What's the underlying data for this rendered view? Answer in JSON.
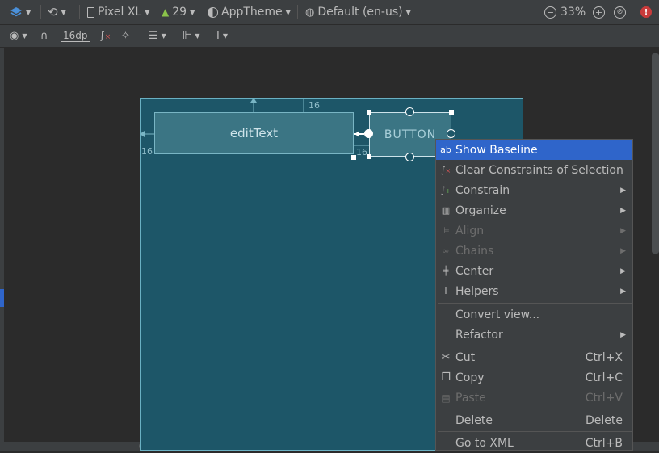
{
  "toolbar": {
    "device": "Pixel XL",
    "api": "29",
    "theme": "AppTheme",
    "locale": "Default (en-us)",
    "zoom": "33%",
    "margin": "16dp"
  },
  "design": {
    "edittext_label": "editText",
    "button_label": "BUTTON",
    "dim_top": "16",
    "dim_left": "16",
    "dim_gap": "16"
  },
  "menu": {
    "items": [
      {
        "label": "Show Baseline",
        "icon": "ab",
        "state": "selected"
      },
      {
        "label": "Clear Constraints of Selection",
        "icon": "clear-constraints-icon"
      },
      {
        "label": "Constrain",
        "icon": "constrain-icon",
        "submenu": true
      },
      {
        "label": "Organize",
        "icon": "organize-icon",
        "submenu": true
      },
      {
        "label": "Align",
        "icon": "align-icon",
        "submenu": true,
        "state": "disabled"
      },
      {
        "label": "Chains",
        "icon": "chains-icon",
        "submenu": true,
        "state": "disabled"
      },
      {
        "label": "Center",
        "icon": "center-icon",
        "submenu": true
      },
      {
        "label": "Helpers",
        "icon": "helpers-icon",
        "submenu": true
      },
      {
        "label": "Convert view..."
      },
      {
        "label": "Refactor",
        "submenu": true
      },
      {
        "label": "Cut",
        "icon": "scissors-icon",
        "shortcut": "Ctrl+X"
      },
      {
        "label": "Copy",
        "icon": "copy-icon",
        "shortcut": "Ctrl+C"
      },
      {
        "label": "Paste",
        "icon": "paste-icon",
        "shortcut": "Ctrl+V",
        "state": "disabled"
      },
      {
        "label": "Delete",
        "shortcut": "Delete"
      },
      {
        "label": "Go to XML",
        "shortcut": "Ctrl+B"
      }
    ]
  },
  "colors": {
    "accent": "#2f65ca",
    "blueprint": "#1d5668",
    "error": "#c93b3b"
  }
}
